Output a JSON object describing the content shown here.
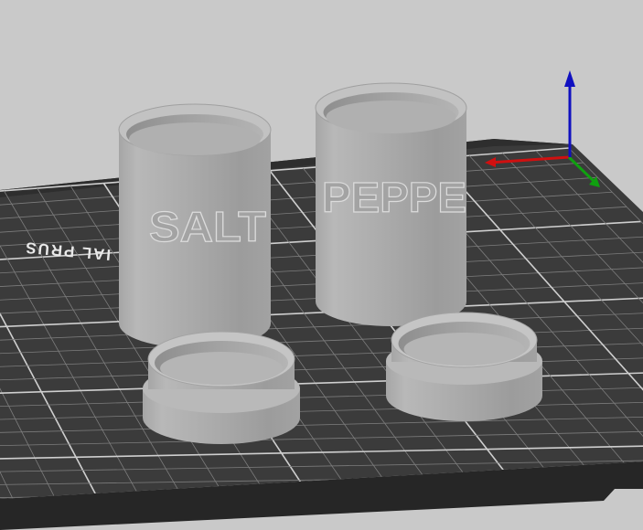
{
  "scene": {
    "background_color": "#c9c9c9",
    "bed_color": "#3b3b3b",
    "bed_frame_color": "#262626",
    "grid_color": "#8a8a8a",
    "model_color": "#a8a8a8",
    "bed_logo_text": "IAL PRUS",
    "objects": [
      {
        "name": "salt-shaker-body",
        "embossed_text": "SALT"
      },
      {
        "name": "pepper-shaker-body",
        "embossed_text": "PEPPE"
      },
      {
        "name": "salt-shaker-lid"
      },
      {
        "name": "pepper-shaker-lid"
      }
    ],
    "axes": {
      "x_color": "#d01010",
      "y_color": "#10a010",
      "z_color": "#1010c0"
    }
  }
}
